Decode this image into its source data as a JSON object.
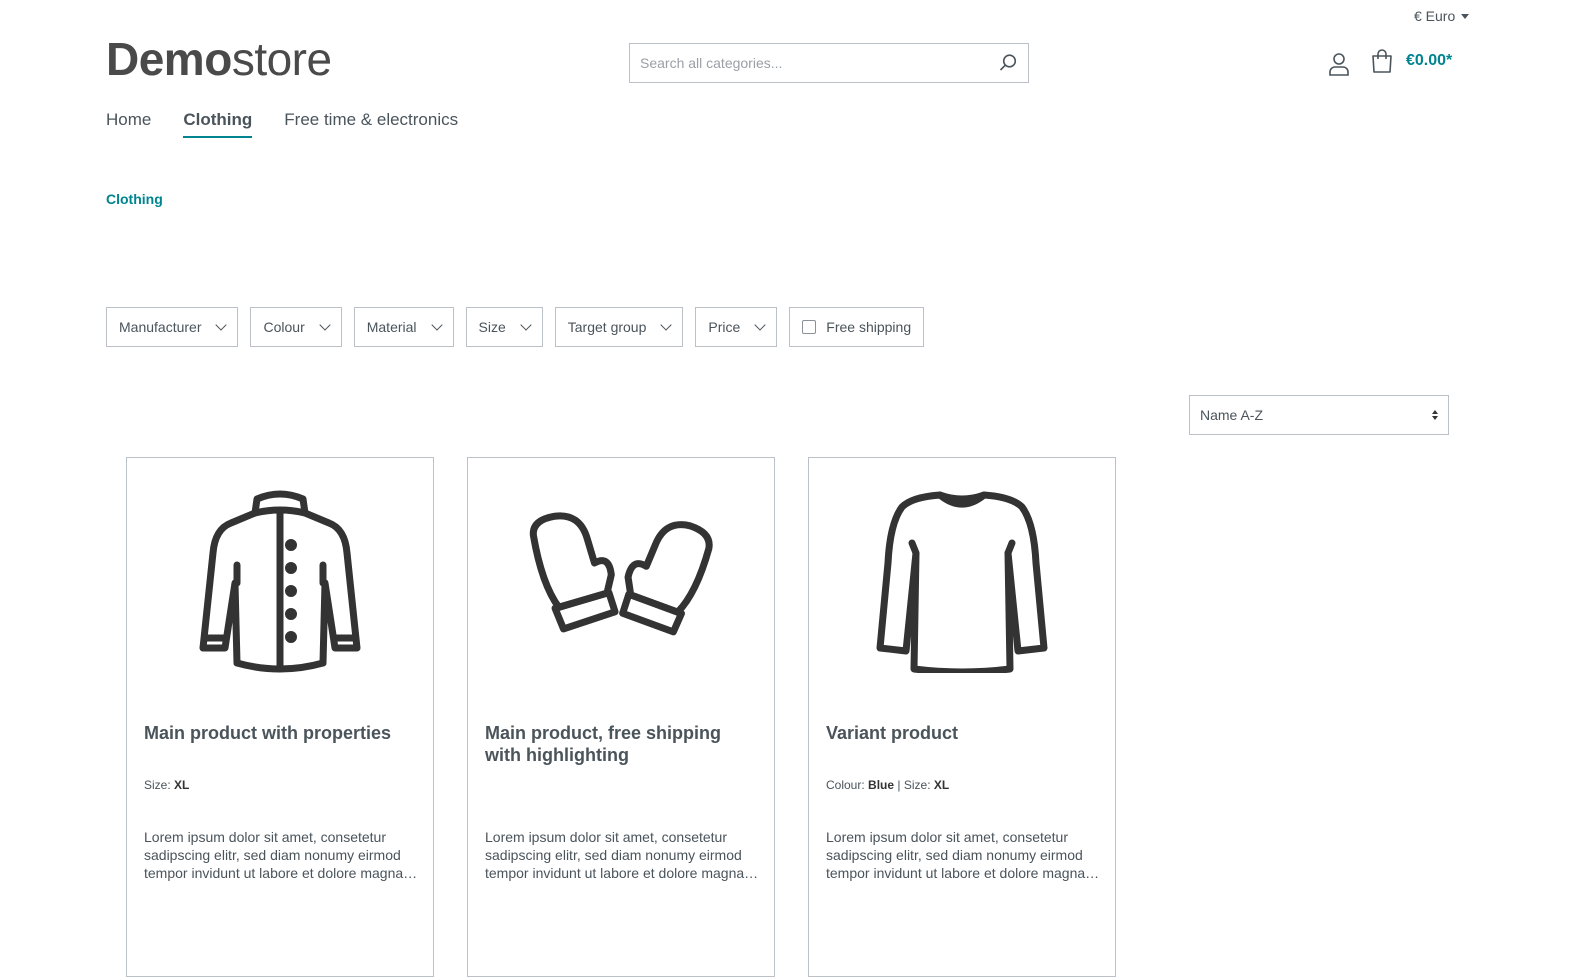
{
  "header": {
    "currency": "€ Euro",
    "logo_bold": "Demo",
    "logo_light": "store",
    "search_placeholder": "Search all categories...",
    "cart_total": "€0.00*"
  },
  "nav": {
    "items": [
      {
        "label": "Home"
      },
      {
        "label": "Clothing"
      },
      {
        "label": "Free time & electronics"
      }
    ],
    "active_index": 1
  },
  "breadcrumb": "Clothing",
  "filters": {
    "manufacturer": "Manufacturer",
    "colour": "Colour",
    "material": "Material",
    "size": "Size",
    "target_group": "Target group",
    "price": "Price",
    "free_shipping": "Free shipping"
  },
  "sorting": {
    "selected": "Name A-Z"
  },
  "products": [
    {
      "title": "Main product with properties",
      "props_label_1": "Size:",
      "props_value_1": "XL",
      "description": "Lorem ipsum dolor sit amet, consetetur sadipscing elitr, sed diam nonumy eirmod tempor invidunt ut labore et dolore magna aliquyam erat, sed diam voluptua.",
      "icon": "jacket-icon"
    },
    {
      "title": "Main product, free shipping with highlighting",
      "description": "Lorem ipsum dolor sit amet, consetetur sadipscing elitr, sed diam nonumy eirmod tempor invidunt ut labore et dolore magna aliquyam erat, sed diam voluptua.",
      "icon": "mittens-icon"
    },
    {
      "title": "Variant product",
      "props_label_1": "Colour:",
      "props_value_1": "Blue",
      "props_sep": " | ",
      "props_label_2": "Size:",
      "props_value_2": "XL",
      "description": "Lorem ipsum dolor sit amet, consetetur sadipscing elitr, sed diam nonumy eirmod tempor invidunt ut labore et dolore magna aliquyam erat, sed diam voluptua.",
      "icon": "sweater-icon"
    }
  ],
  "colors": {
    "accent": "#008490",
    "text": "#4a545b",
    "border": "#bcc1c7"
  }
}
